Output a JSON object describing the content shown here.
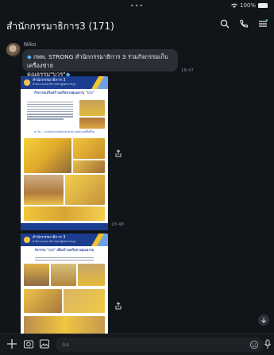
{
  "status": {
    "dots": "•••",
    "battery_text": "100%"
  },
  "header": {
    "title": "สำนักกรรมาธิการ3 (171)",
    "icons": [
      "search-icon",
      "phone-icon",
      "menu-icon"
    ]
  },
  "message": {
    "sender": "Niko",
    "text_line1": "กพพ. STRONG สำนักกรรมาธิการ 3 ร่วมกิจกรรมเก็บเครื่องข่าย",
    "text_line2": "คุณธรรม\"บวร\"",
    "time": "18:47"
  },
  "posters": [
    {
      "org": "สำนักกรรมาธิการ 3",
      "sub": "สำนักงานเลขาธิการสภาผู้แทนราษฎร",
      "heading": "กิจกรรมเสริมสร้างเครือข่ายคุณธรรม \"บวร\"",
      "caption": "ณ วัด... ร่วมกิจกรรมจิตอาสาทำความสะอาดพื้นที่วัด",
      "time": "18:48"
    },
    {
      "org": "สำนักกรรมาธิการ 3",
      "sub": "สำนักงานเลขาธิการสภาผู้แทนราษฎร",
      "heading": "กิจกรรม \"บวร\" เพื่อสร้างเครือข่ายคุณธรรม",
      "caption": "",
      "time": ""
    }
  ],
  "composer": {
    "placeholder": "Aa",
    "icons": [
      "plus-icon",
      "camera-icon",
      "image-icon",
      "emoji-icon",
      "mic-icon"
    ]
  },
  "colors": {
    "background": "#111418",
    "bubble": "#2a2f36",
    "accent": "#4fb3ff",
    "poster_header": "#1b3d8f",
    "poster_yellow": "#f2c230"
  }
}
